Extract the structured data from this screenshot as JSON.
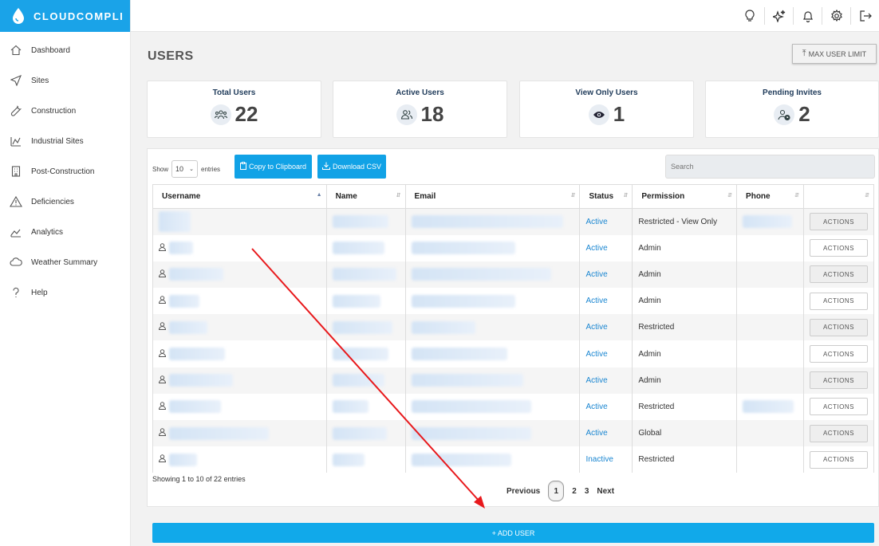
{
  "brand": {
    "name": "CLOUDCOMPLI"
  },
  "sidebar": {
    "items": [
      {
        "label": "Dashboard",
        "icon": "home-icon"
      },
      {
        "label": "Sites",
        "icon": "navigation-arrow-icon"
      },
      {
        "label": "Construction",
        "icon": "wrench-icon"
      },
      {
        "label": "Industrial Sites",
        "icon": "industry-icon"
      },
      {
        "label": "Post-Construction",
        "icon": "building-icon"
      },
      {
        "label": "Deficiencies",
        "icon": "warning-icon"
      },
      {
        "label": "Analytics",
        "icon": "chart-icon"
      },
      {
        "label": "Weather Summary",
        "icon": "cloud-icon"
      },
      {
        "label": "Help",
        "icon": "help-icon"
      }
    ]
  },
  "topbar": {
    "icons": [
      "lightbulb-icon",
      "sparkle-icon",
      "bell-icon",
      "gear-icon",
      "logout-icon"
    ]
  },
  "page": {
    "title": "USERS",
    "max_user_limit_label": "MAX USER LIMIT"
  },
  "stats": {
    "total": {
      "title": "Total Users",
      "value": "22"
    },
    "active": {
      "title": "Active Users",
      "value": "18"
    },
    "view_only": {
      "title": "View Only Users",
      "value": "1"
    },
    "pending": {
      "title": "Pending Invites",
      "value": "2"
    }
  },
  "table_controls": {
    "show_label": "Show",
    "entries_value": "10",
    "entries_label": "entries",
    "copy_label": "Copy to Clipboard",
    "download_label": "Download CSV",
    "search_placeholder": "Search"
  },
  "table": {
    "columns": [
      "Username",
      "Name",
      "Email",
      "Status",
      "Permission",
      "Phone",
      ""
    ],
    "rows": [
      {
        "status": "Active",
        "permission": "Restricted - View Only",
        "action": "ACTIONS"
      },
      {
        "status": "Active",
        "permission": "Admin",
        "action": "ACTIONS"
      },
      {
        "status": "Active",
        "permission": "Admin",
        "action": "ACTIONS"
      },
      {
        "status": "Active",
        "permission": "Admin",
        "action": "ACTIONS"
      },
      {
        "status": "Active",
        "permission": "Restricted",
        "action": "ACTIONS"
      },
      {
        "status": "Active",
        "permission": "Admin",
        "action": "ACTIONS"
      },
      {
        "status": "Active",
        "permission": "Admin",
        "action": "ACTIONS"
      },
      {
        "status": "Active",
        "permission": "Restricted",
        "action": "ACTIONS"
      },
      {
        "status": "Active",
        "permission": "Global",
        "action": "ACTIONS"
      },
      {
        "status": "Inactive",
        "permission": "Restricted",
        "action": "ACTIONS"
      }
    ],
    "info": "Showing 1 to 10 of 22 entries"
  },
  "pagination": {
    "previous": "Previous",
    "pages": [
      "1",
      "2",
      "3"
    ],
    "current": "1",
    "next": "Next"
  },
  "add_user_label": "+ ADD USER",
  "colors": {
    "brand": "#1aa3e8",
    "button": "#11a2e6",
    "link": "#1a86d1",
    "annotation": "#e8191c"
  }
}
